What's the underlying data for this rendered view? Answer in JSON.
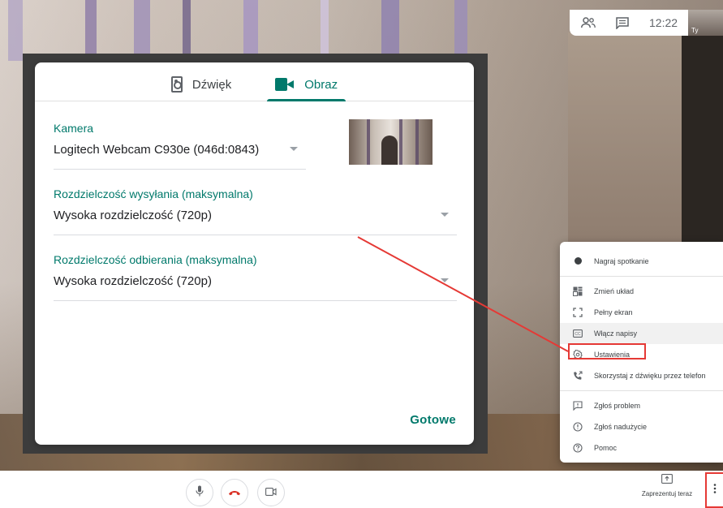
{
  "topbar": {
    "clock": "12:22",
    "self_label": "Ty"
  },
  "dialog": {
    "tabs": [
      {
        "label": "Dźwięk",
        "icon": "speaker-icon",
        "active": false
      },
      {
        "label": "Obraz",
        "icon": "videocam-icon",
        "active": true
      }
    ],
    "camera": {
      "label": "Kamera",
      "value": "Logitech Webcam C930e (046d:0843)"
    },
    "send_resolution": {
      "label": "Rozdzielczość wysyłania (maksymalna)",
      "value": "Wysoka rozdzielczość (720p)"
    },
    "receive_resolution": {
      "label": "Rozdzielczość odbierania (maksymalna)",
      "value": "Wysoka rozdzielczość (720p)"
    },
    "done_label": "Gotowe"
  },
  "menu": {
    "items": [
      {
        "label": "Nagraj spotkanie",
        "icon": "record-icon"
      },
      {
        "label": "Zmień układ",
        "icon": "layout-icon"
      },
      {
        "label": "Pełny ekran",
        "icon": "fullscreen-icon"
      },
      {
        "label": "Włącz napisy",
        "icon": "captions-icon"
      },
      {
        "label": "Ustawienia",
        "icon": "settings-icon"
      },
      {
        "label": "Skorzystaj z dźwięku przez telefon",
        "icon": "phone-icon"
      },
      {
        "label": "Zgłoś problem",
        "icon": "feedback-icon"
      },
      {
        "label": "Zgłoś nadużycie",
        "icon": "report-icon"
      },
      {
        "label": "Pomoc",
        "icon": "help-icon"
      }
    ]
  },
  "bottom_bar": {
    "present_label": "Zaprezentuj teraz"
  },
  "colors": {
    "accent": "#00796b",
    "annotation": "#e53935",
    "hangup": "#d93025"
  }
}
